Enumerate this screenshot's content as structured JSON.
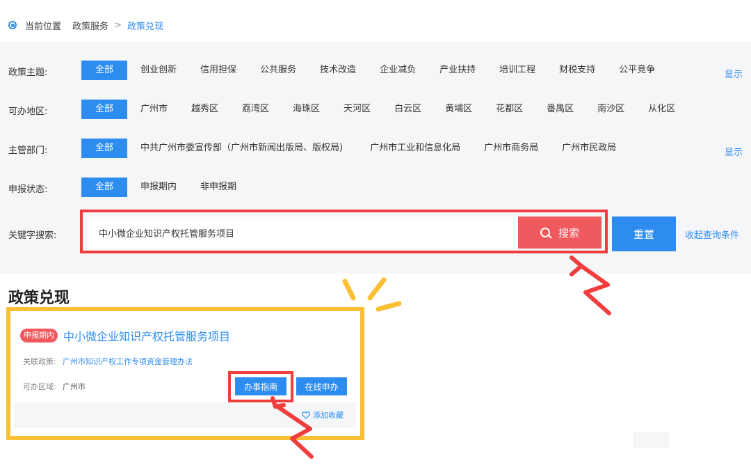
{
  "breadcrumb": {
    "prefix": "当前位置",
    "parent": "政策服务",
    "separator": ">",
    "current": "政策兑现"
  },
  "filters": {
    "theme": {
      "label": "政策主题:",
      "options": [
        "全部",
        "创业创新",
        "信用担保",
        "公共服务",
        "技术改造",
        "企业减负",
        "产业扶持",
        "培训工程",
        "财税支持",
        "公平竞争"
      ],
      "more": "显示"
    },
    "region": {
      "label": "可办地区:",
      "options": [
        "全部",
        "广州市",
        "越秀区",
        "荔湾区",
        "海珠区",
        "天河区",
        "白云区",
        "黄埔区",
        "花都区",
        "番禺区",
        "南沙区",
        "从化区"
      ]
    },
    "department": {
      "label": "主管部门:",
      "options": [
        "全部",
        "中共广州市委宣传部（广州市新闻出版局、版权局)",
        "广州市工业和信息化局",
        "广州市商务局",
        "广州市民政局"
      ],
      "more": "显示"
    },
    "status": {
      "label": "申报状态:",
      "options": [
        "全部",
        "申报期内",
        "非申报期"
      ]
    }
  },
  "search": {
    "label": "关键字搜索:",
    "value": "中小微企业知识产权托管服务项目",
    "button": "搜索",
    "reset": "重置",
    "collapse": "收起查询条件"
  },
  "results": {
    "title": "政策兑现",
    "card": {
      "status": "申报期内",
      "title": "中小微企业知识产权托管服务项目",
      "policy_label": "关联政策:",
      "policy_link": "广州市知识产权工作专项资金管理办法",
      "region_label": "可办区域:",
      "region_value": "广州市",
      "guide_button": "办事指南",
      "online_button": "在线申办",
      "favorite": "添加收藏"
    }
  },
  "colors": {
    "accent": "#2d8cf0",
    "highlight_red": "#f03d3d",
    "highlight_yellow": "#fbbf35",
    "search_button": "#f05a5e"
  },
  "icons": [
    "location-icon",
    "search-icon",
    "heart-icon"
  ]
}
